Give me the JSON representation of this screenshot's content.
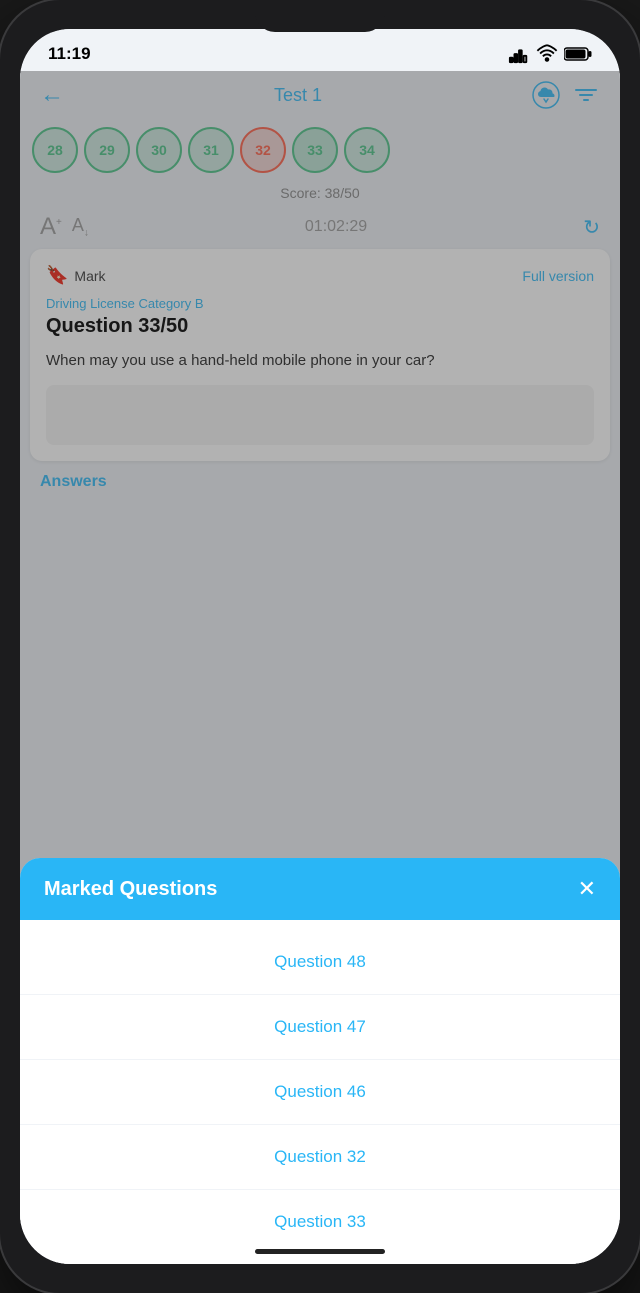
{
  "statusBar": {
    "time": "11:19",
    "batteryIcon": "🔋"
  },
  "header": {
    "backLabel": "←",
    "title": "Test 1"
  },
  "bubbles": [
    {
      "number": "28",
      "state": "green"
    },
    {
      "number": "29",
      "state": "green"
    },
    {
      "number": "30",
      "state": "green"
    },
    {
      "number": "31",
      "state": "green"
    },
    {
      "number": "32",
      "state": "red"
    },
    {
      "number": "33",
      "state": "green"
    },
    {
      "number": "34",
      "state": "green"
    }
  ],
  "score": "Score: 38/50",
  "timer": "01:02:29",
  "markLabel": "Mark",
  "fullVersionLabel": "Full version",
  "categoryLabel": "Driving License Category B",
  "questionNumber": "Question 33/50",
  "questionText": "When may you use a hand-held mobile phone in your car?",
  "answersLabel": "Answers",
  "modal": {
    "title": "Marked Questions",
    "closeLabel": "✕",
    "items": [
      "Question 48",
      "Question 47",
      "Question 46",
      "Question 32",
      "Question 33"
    ]
  }
}
